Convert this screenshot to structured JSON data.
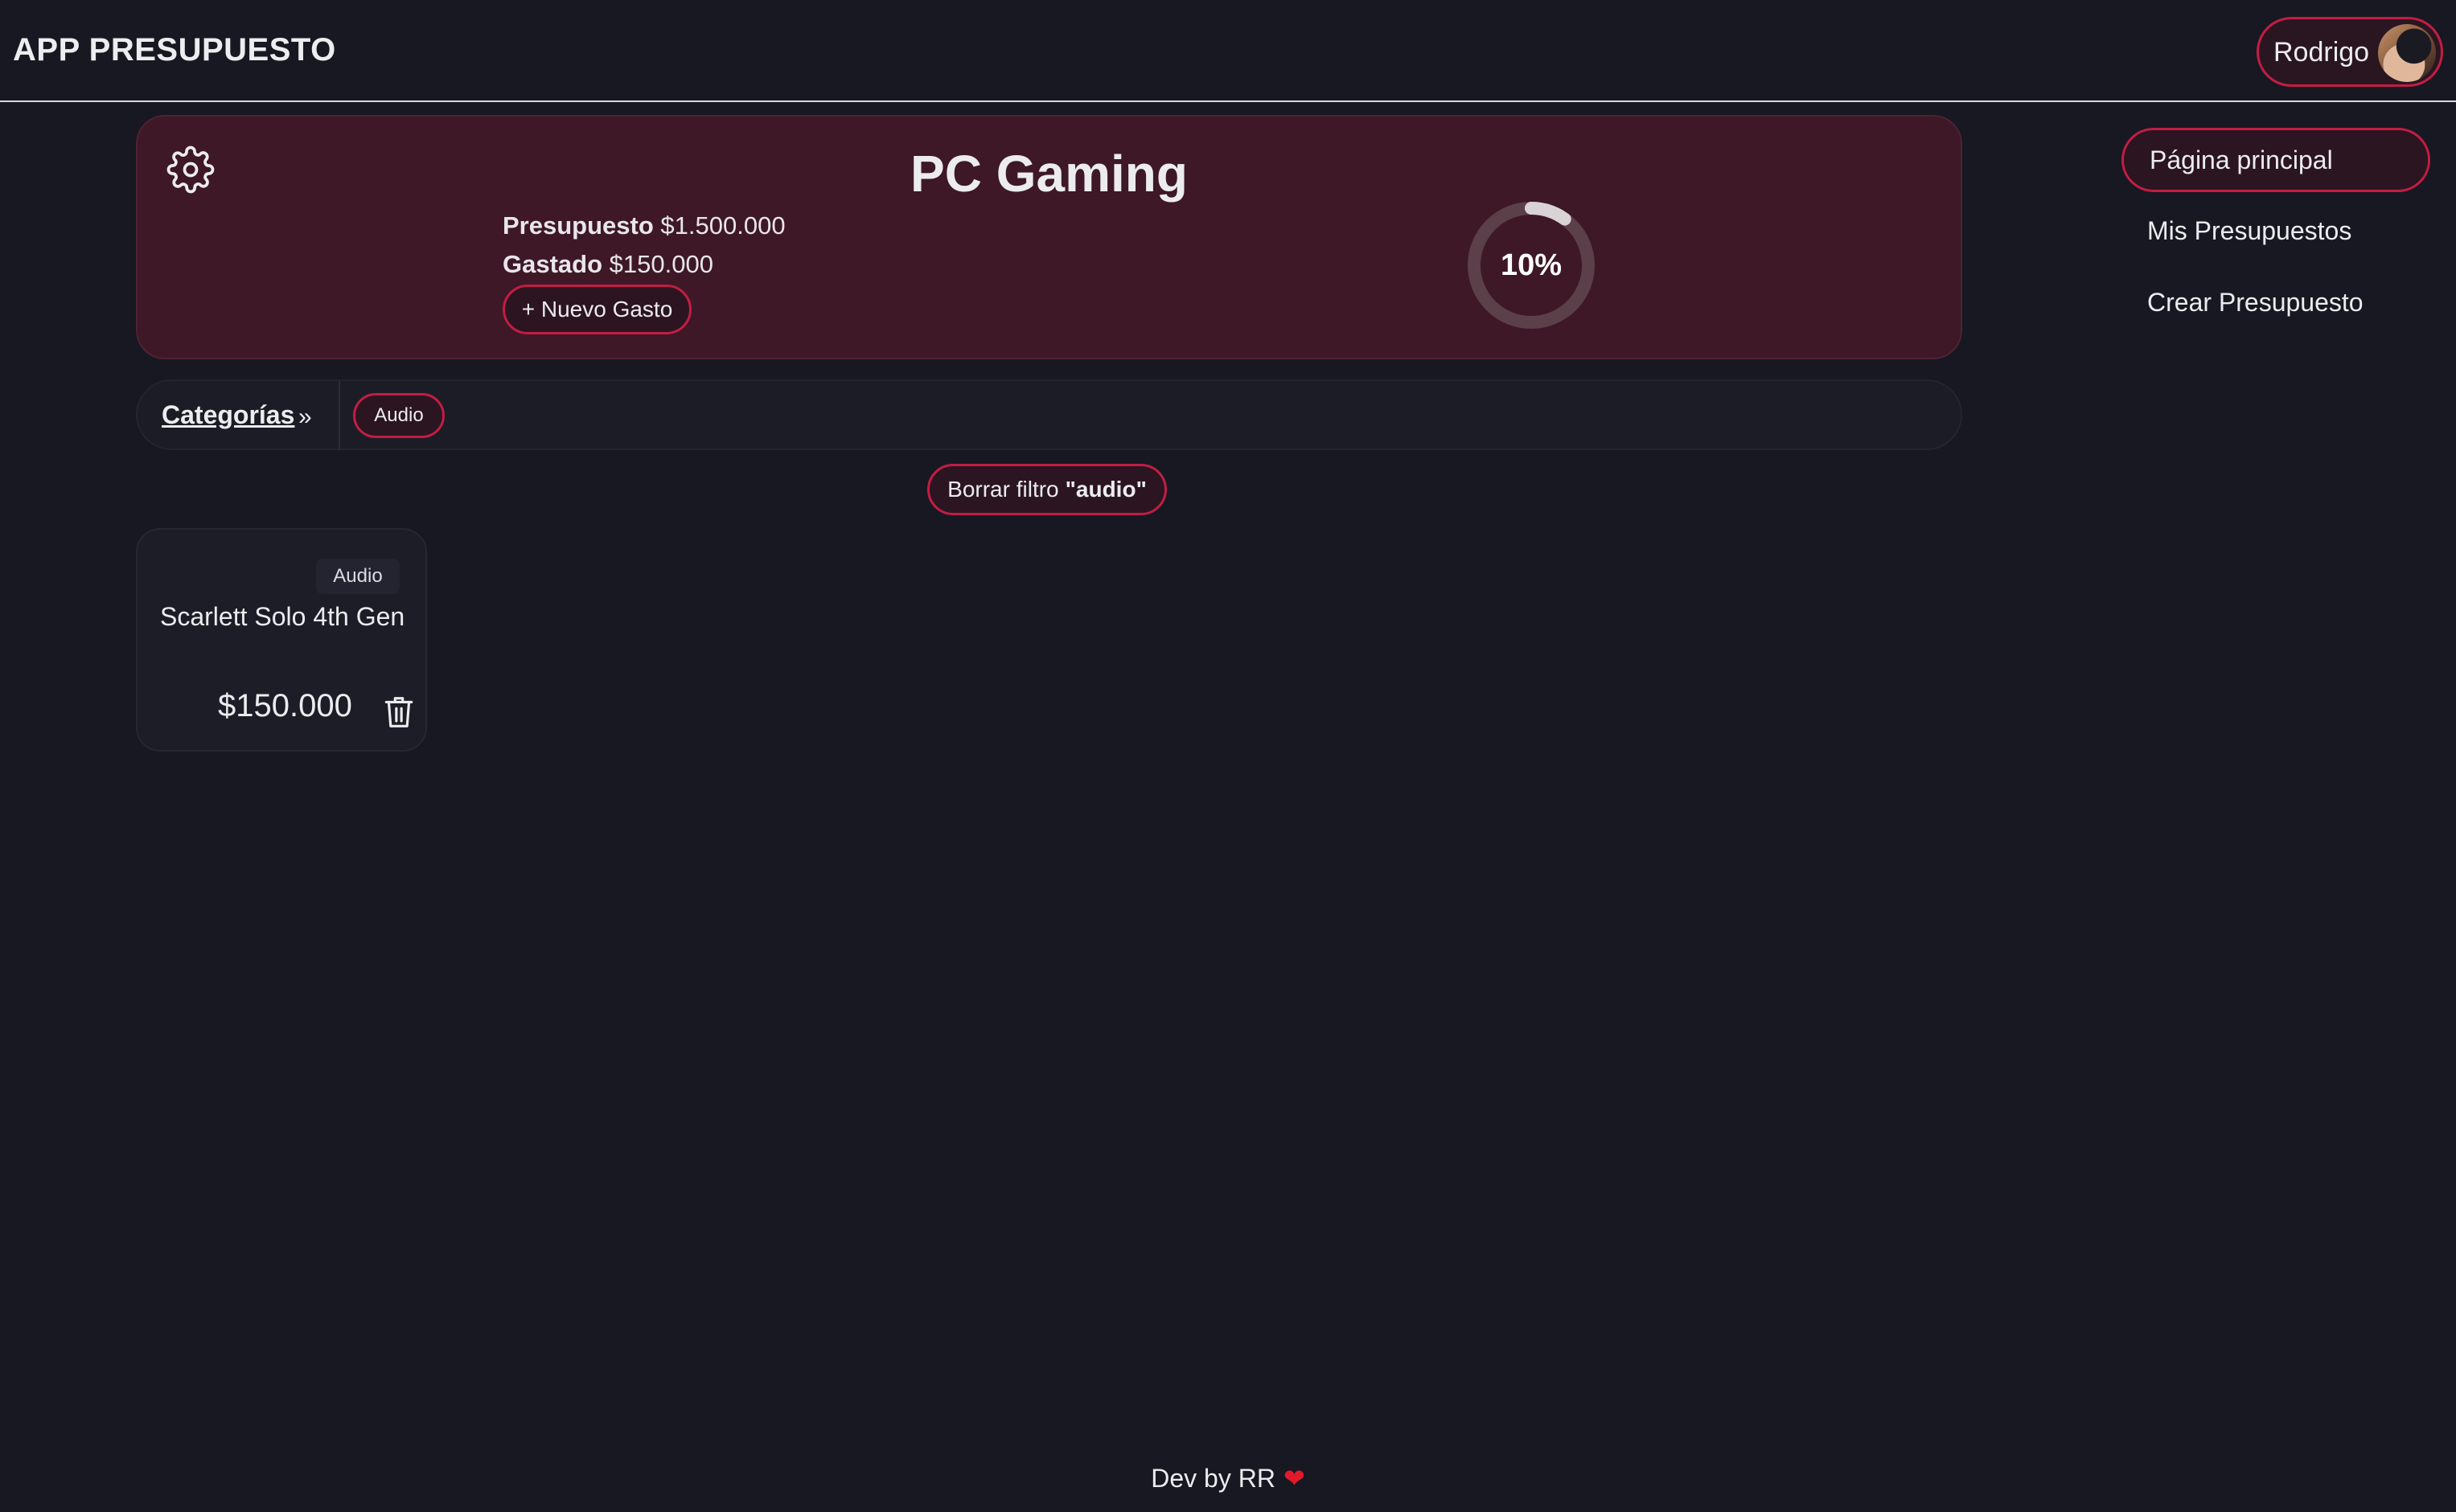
{
  "header": {
    "app_title": "APP PRESUPUESTO",
    "user_name": "Rodrigo"
  },
  "budget": {
    "title": "PC Gaming",
    "budget_label": "Presupuesto",
    "budget_value": "$1.500.000",
    "spent_label": "Gastado",
    "spent_value": "$150.000",
    "new_expense_label": "+ Nuevo Gasto",
    "progress_text": "10%",
    "progress_fraction": 0.1
  },
  "categories": {
    "label": "Categorías",
    "chevron": "»",
    "chips": [
      "Audio"
    ]
  },
  "filter": {
    "clear_prefix": "Borrar filtro",
    "clear_value": "\"audio\""
  },
  "expenses": [
    {
      "category": "Audio",
      "name": "Scarlett Solo 4th Gen",
      "amount": "$150.000"
    }
  ],
  "nav": {
    "items": [
      "Página principal",
      "Mis Presupuestos",
      "Crear Presupuesto"
    ],
    "active_index": 0
  },
  "footer": {
    "text": "Dev by RR",
    "heart": "❤"
  },
  "colors": {
    "background": "#171821",
    "accent": "#c21d44",
    "card": "#3e1826"
  },
  "icons": {
    "settings": "gear-icon",
    "delete": "trash-icon"
  }
}
